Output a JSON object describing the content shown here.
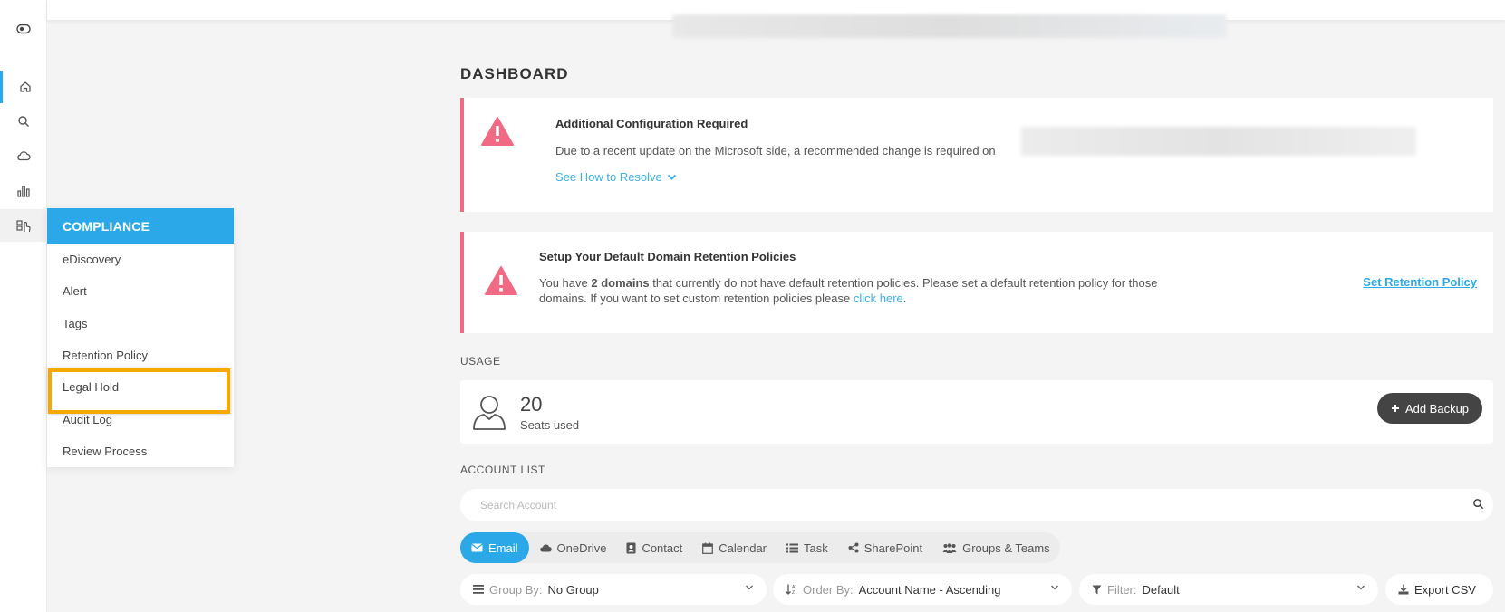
{
  "rail": {
    "icons": [
      "toggle-icon",
      "home-icon",
      "search-icon",
      "cloud-icon",
      "chart-icon",
      "compliance-icon"
    ]
  },
  "flyout": {
    "header": "COMPLIANCE",
    "items": [
      "eDiscovery",
      "Alert",
      "Tags",
      "Retention Policy",
      "Legal Hold",
      "Audit Log",
      "Review Process"
    ]
  },
  "page": {
    "title": "DASHBOARD"
  },
  "alert_config": {
    "title": "Additional Configuration Required",
    "text": "Due to a recent update on the Microsoft side, a recommended change is required on",
    "link": "See How to Resolve"
  },
  "alert_retention": {
    "title": "Setup Your Default Domain Retention Policies",
    "text_before": "You have ",
    "text_bold": "2 domains",
    "text_after": " that currently do not have default retention policies. Please set a default retention policy for those domains. If you want to set custom retention policies please ",
    "text_link": "click here",
    "text_end": ".",
    "action": "Set Retention Policy"
  },
  "usage": {
    "label": "USAGE",
    "seats": "20",
    "seats_label": "Seats used",
    "add_button": "Add Backup"
  },
  "accounts": {
    "label": "ACCOUNT LIST",
    "search_placeholder": "Search Account",
    "tabs": [
      "Email",
      "OneDrive",
      "Contact",
      "Calendar",
      "Task",
      "SharePoint",
      "Groups & Teams"
    ],
    "group_by_label": "Group By:",
    "group_by_value": "No Group",
    "order_by_label": "Order By:",
    "order_by_value": "Account Name - Ascending",
    "filter_label": "Filter:",
    "filter_value": "Default",
    "export_label": "Export CSV"
  },
  "colors": {
    "accent": "#2aa8e8",
    "alert": "#f06a84",
    "highlight": "#f5a800"
  }
}
